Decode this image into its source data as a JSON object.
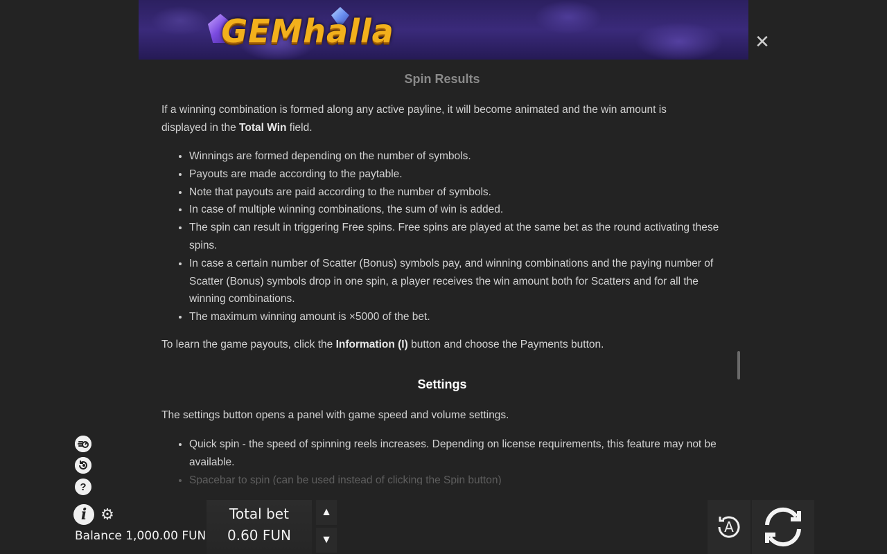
{
  "header": {
    "logo_text": "GEMhalla"
  },
  "content": {
    "spin_results_title": "Spin Results",
    "intro_before": "If a winning combination is formed along any active payline, it will become animated and the win amount is displayed in the ",
    "intro_bold": "Total Win",
    "intro_after": " field.",
    "spin_results_list": [
      "Winnings are formed depending on the number of symbols.",
      "Payouts are made according to the paytable.",
      "Note that payouts are paid according to the number of symbols.",
      "In case of multiple winning combinations, the sum of win is added.",
      "The spin can result in triggering Free spins. Free spins are played at the same bet as the round activating these spins.",
      "In case a certain number of Scatter (Bonus) symbols pay, and winning combinations and the paying number of Scatter (Bonus) symbols drop in one spin, a player receives the win amount both for Scatters and for all the winning combinations.",
      "The maximum winning amount is ×5000 of the bet."
    ],
    "payouts_before": "To learn the game payouts, click the ",
    "payouts_bold": "Information (I)",
    "payouts_after": " button and choose the Payments button.",
    "settings_title": "Settings",
    "settings_intro": "The settings button opens a panel with game speed and volume settings.",
    "settings_list": [
      "Quick spin - the speed of spinning reels increases. Depending on license requirements, this feature may not be available.",
      "Spacebar to spin (can be used instead of clicking the Spin button)"
    ]
  },
  "footer": {
    "balance_label": "Balance",
    "balance_value": "1,000.00 FUN",
    "total_bet_label": "Total bet",
    "total_bet_value": "0.60 FUN",
    "auto_label": "A",
    "help_glyph": "?",
    "info_glyph": "i"
  },
  "icons": {
    "close": "close-icon",
    "turbo": "turbo-icon",
    "history": "history-icon",
    "help": "question-icon",
    "info": "info-icon",
    "settings": "gear-icon",
    "up": "arrow-up-icon",
    "down": "arrow-down-icon",
    "autoplay": "autoplay-icon",
    "spin": "spin-icon"
  }
}
